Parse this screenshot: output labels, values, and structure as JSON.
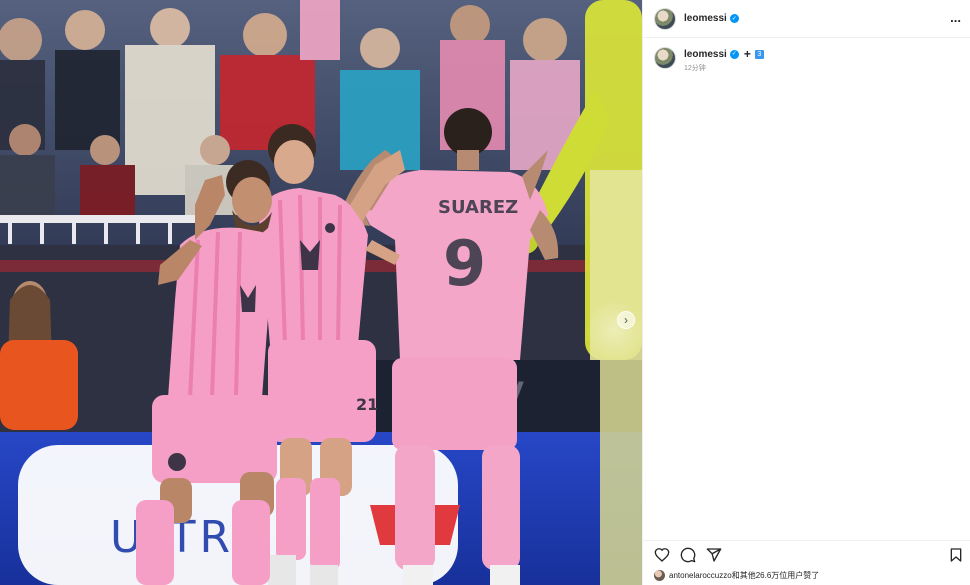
{
  "header": {
    "username": "leomessi",
    "more_label": "..."
  },
  "caption": {
    "username": "leomessi",
    "plus": "+",
    "badge": "3",
    "time": "12分钟"
  },
  "photo": {
    "jersey_name": "SUAREZ",
    "jersey_number": "9",
    "shorts_number": "21",
    "board_text": "ULTRA",
    "colors": {
      "kit_pink": "#f4a6c9",
      "crowd_bg": "#3b4a6b",
      "board_blue": "#1e3fb8"
    }
  },
  "post_footer": {
    "likes_text": "antonelaroccuzzo和其他26.6万位用户赞了"
  },
  "icons": [
    "verified-icon",
    "more-icon",
    "heart-icon",
    "comment-icon",
    "share-icon",
    "bookmark-icon",
    "chevron-right-icon"
  ]
}
